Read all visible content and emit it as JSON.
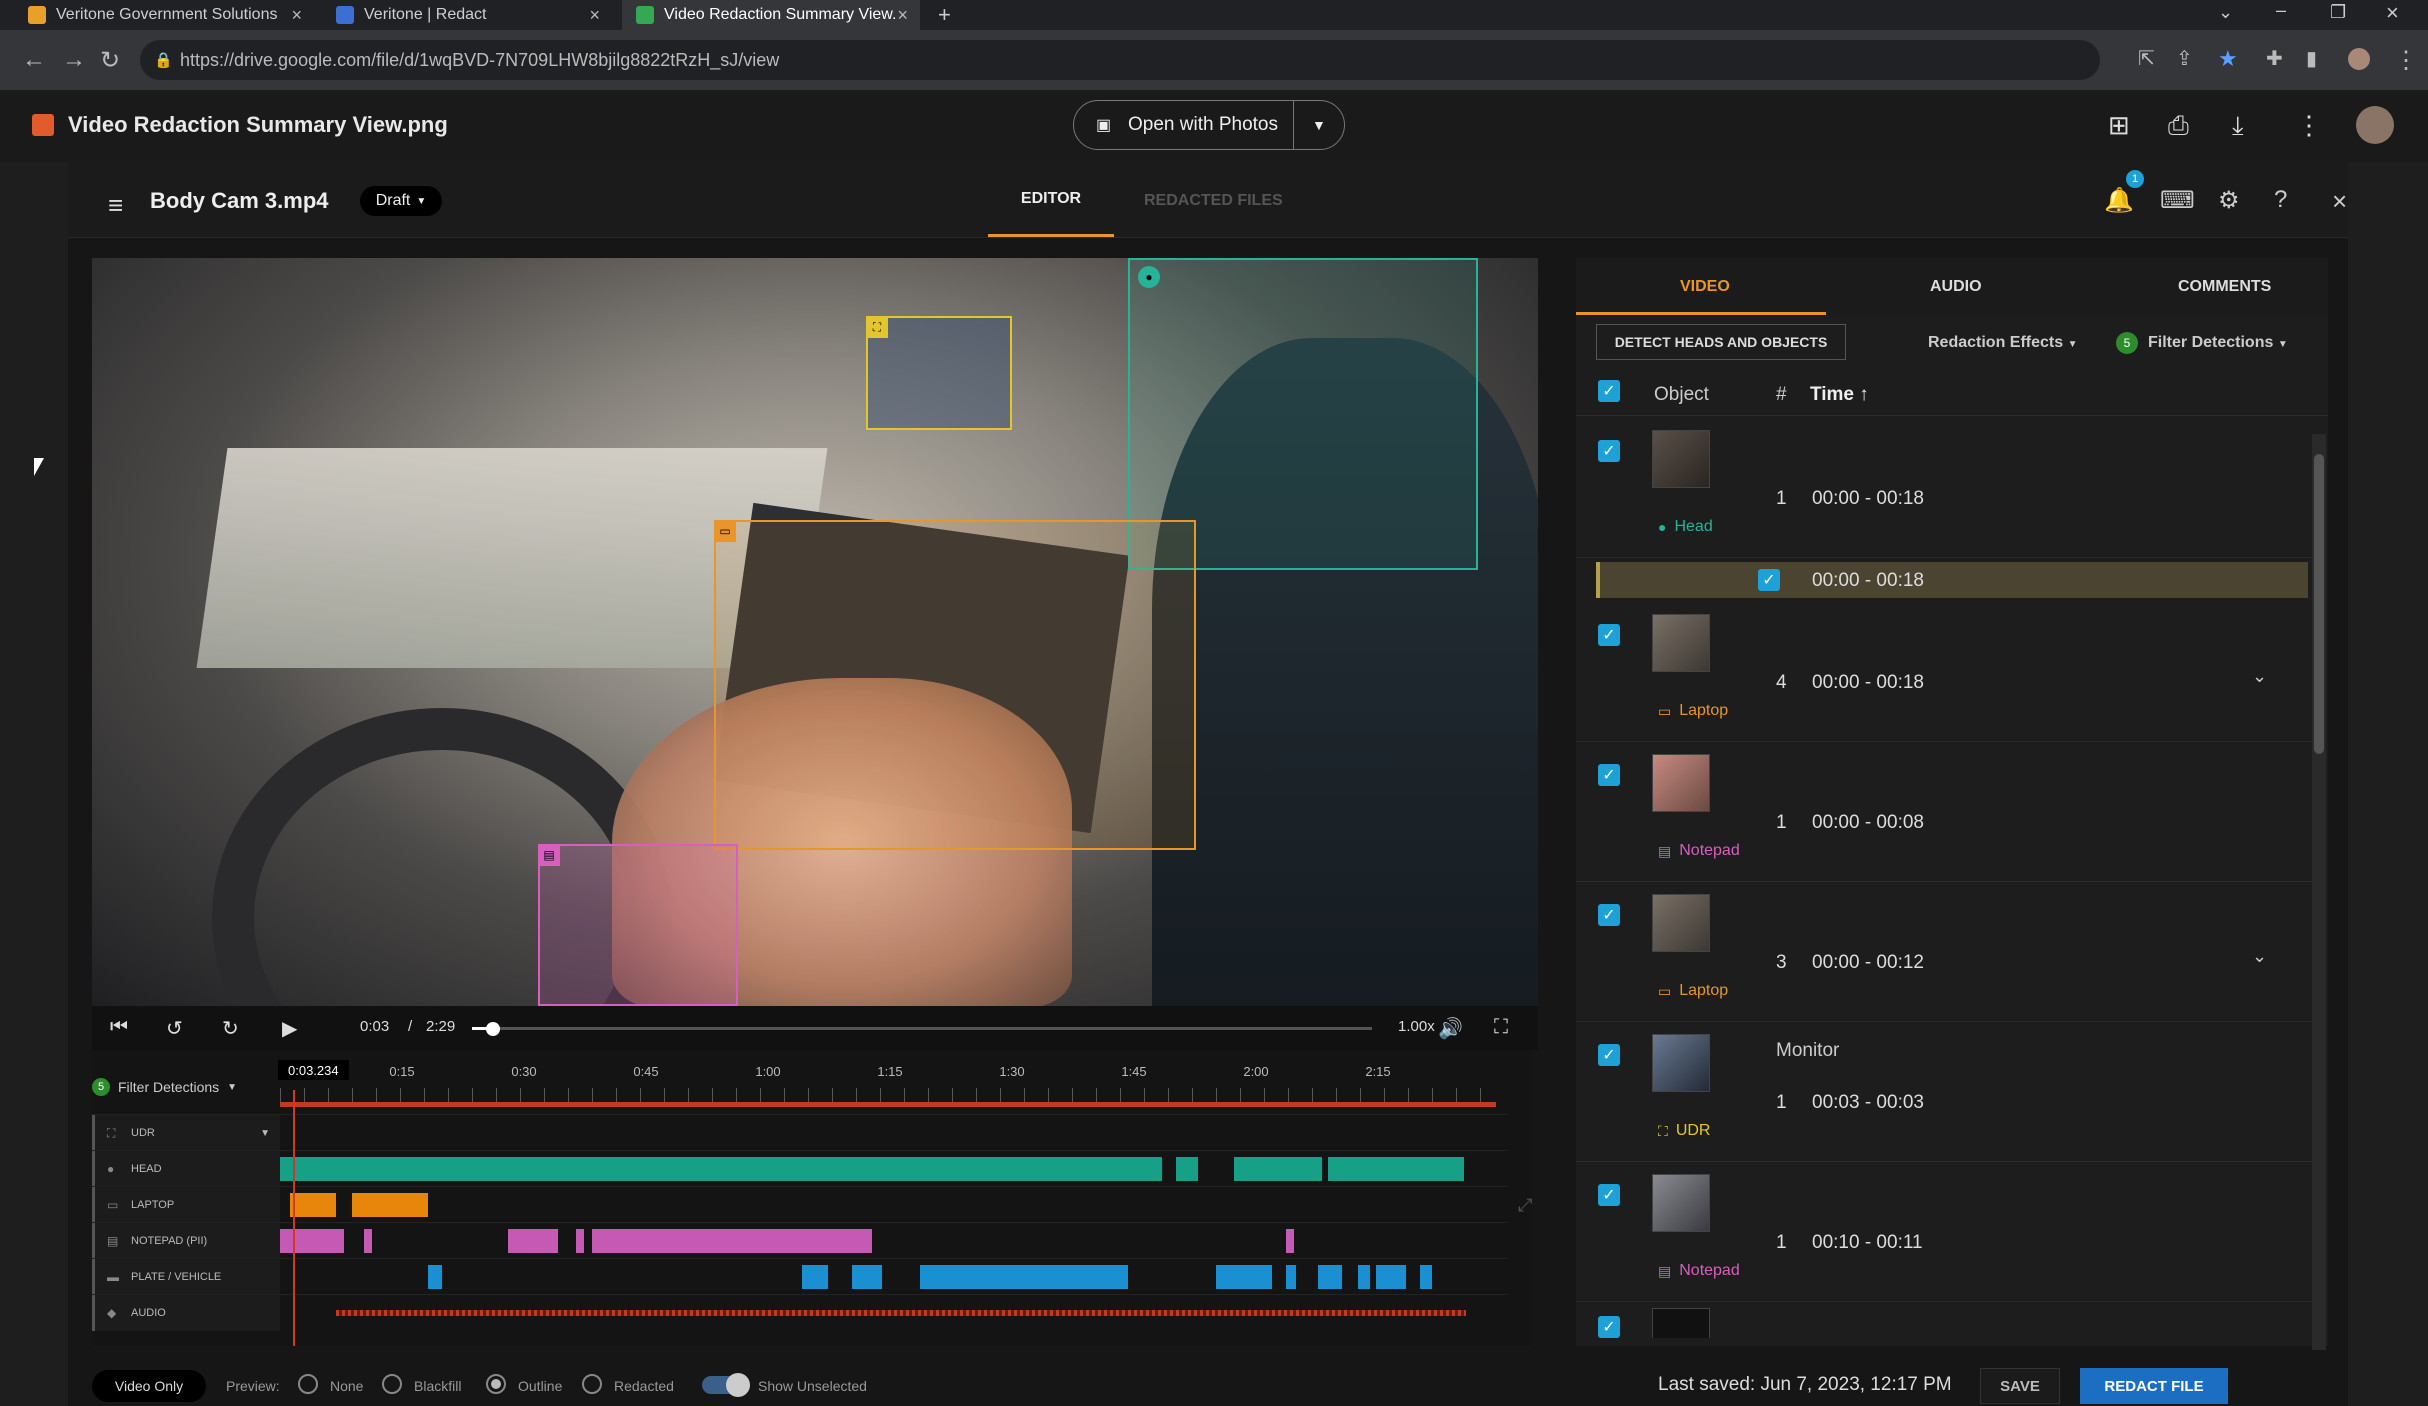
{
  "browser": {
    "tabs": [
      {
        "label": "Veritone Government Solutions"
      },
      {
        "label": "Veritone | Redact"
      },
      {
        "label": "Video Redaction Summary View."
      }
    ],
    "url": "https://drive.google.com/file/d/1wqBVD-7N709LHW8bjilg8822tRzH_sJ/view"
  },
  "drive": {
    "title": "Video Redaction Summary View.png",
    "open_with": "Open with Photos"
  },
  "app": {
    "file_title": "Body Cam 3.mp4",
    "status": "Draft",
    "tabs": {
      "editor": "EDITOR",
      "redacted": "REDACTED FILES"
    },
    "notifications": "1"
  },
  "player": {
    "current": "0:03",
    "separator": "/",
    "total": "2:29",
    "speed": "1.00x",
    "progress": 0.02
  },
  "timeline": {
    "current_marker": "0:03.234",
    "ruler": [
      "0",
      "0:15",
      "0:30",
      "0:45",
      "1:00",
      "1:15",
      "1:30",
      "1:45",
      "2:00",
      "2:15"
    ],
    "filter_count": "5",
    "filter_label": "Filter Detections",
    "tracks": [
      {
        "label": "UDR"
      },
      {
        "label": "HEAD"
      },
      {
        "label": "LAPTOP"
      },
      {
        "label": "NOTEPAD (PII)"
      },
      {
        "label": "PLATE / VEHICLE"
      },
      {
        "label": "AUDIO"
      }
    ]
  },
  "bottom": {
    "mode": "Video Only",
    "preview_label": "Preview:",
    "options": [
      "None",
      "Blackfill",
      "Outline",
      "Redacted"
    ],
    "selected_option": "Outline",
    "show_unselected": "Show Unselected",
    "last_saved": "Last saved: Jun 7, 2023, 12:17 PM",
    "save": "SAVE",
    "redact": "REDACT FILE"
  },
  "panel": {
    "tabs": [
      "VIDEO",
      "AUDIO",
      "COMMENTS"
    ],
    "detect_button": "DETECT HEADS AND OBJECTS",
    "redaction_effects": "Redaction Effects",
    "filter_count": "5",
    "filter_detections": "Filter Detections",
    "headers": {
      "object": "Object",
      "num": "#",
      "time": "Time ↑"
    },
    "rows": [
      {
        "label": "Head",
        "num": "1",
        "time": "00:00 - 00:18",
        "color": "#27b39a"
      },
      {
        "sub_time": "00:00 - 00:18"
      },
      {
        "label": "Laptop",
        "num": "4",
        "time": "00:00 - 00:18",
        "color": "#e8952b"
      },
      {
        "label": "Notepad",
        "num": "1",
        "time": "00:00 - 00:08",
        "color": "#d65fbf"
      },
      {
        "label": "Laptop",
        "num": "3",
        "time": "00:00 - 00:12",
        "color": "#e8952b"
      },
      {
        "label": "UDR",
        "name": "Monitor",
        "num": "1",
        "time": "00:03 - 00:03",
        "color": "#e3c62b"
      },
      {
        "label": "Notepad",
        "num": "1",
        "time": "00:10 - 00:11",
        "color": "#d65fbf"
      }
    ]
  },
  "colors": {
    "accent": "#e8952b",
    "head": "#27b39a",
    "laptop": "#e8952b",
    "notepad": "#d65fbf",
    "udr": "#e3c62b",
    "plate": "#1da1d6",
    "primary": "#1b6ec2"
  }
}
